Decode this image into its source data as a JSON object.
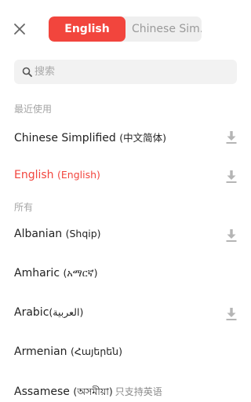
{
  "header": {
    "close_icon": "close-icon",
    "tabs": [
      {
        "label": "English",
        "active": true
      },
      {
        "label": "Chinese Sim...",
        "active": false
      }
    ]
  },
  "search": {
    "placeholder": "搜索",
    "value": ""
  },
  "sections": {
    "recent_label": "最近使用",
    "all_label": "所有"
  },
  "recent_languages": [
    {
      "name": "Chinese Simplified",
      "native": "(中文简体)",
      "download_icon": true
    },
    {
      "name": "English",
      "native": "(English)",
      "download_icon": true,
      "selected": true
    }
  ],
  "all_languages": [
    {
      "name": "Albanian",
      "native": "(Shqip)",
      "download_icon": true
    },
    {
      "name": "Amharic",
      "native": "(አማርኛ)",
      "download_icon": false
    },
    {
      "name": "Arabic",
      "native": "(العربية)",
      "download_icon": true
    },
    {
      "name": "Armenian",
      "native": "(Հայերեն)",
      "download_icon": false
    },
    {
      "name": "Assamese",
      "native": "(অসমীয়া)",
      "note": "只支持英语",
      "download_icon": false
    }
  ],
  "colors": {
    "accent": "#f2453d",
    "section_text": "#a5a5a5",
    "icon_gray": "#b5b5b5",
    "search_bg": "#f2f2f2"
  }
}
